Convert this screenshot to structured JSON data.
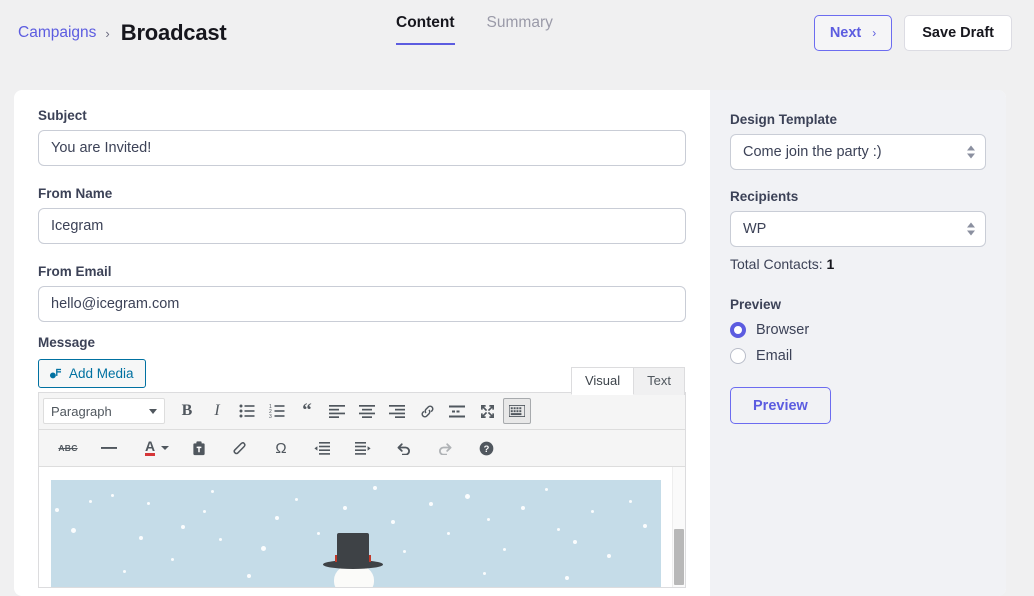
{
  "header": {
    "breadcrumb_parent": "Campaigns",
    "breadcrumb_sep": "›",
    "breadcrumb_current": "Broadcast",
    "tabs": [
      {
        "label": "Content",
        "active": true
      },
      {
        "label": "Summary",
        "active": false
      }
    ],
    "next_label": "Next",
    "next_chevron": "›",
    "save_draft_label": "Save Draft"
  },
  "form": {
    "subject_label": "Subject",
    "subject_value": "You are Invited!",
    "from_name_label": "From Name",
    "from_name_value": "Icegram",
    "from_email_label": "From Email",
    "from_email_value": "hello@icegram.com",
    "message_label": "Message",
    "add_media_label": "Add Media"
  },
  "editor": {
    "mode_tabs": [
      {
        "label": "Visual",
        "active": true
      },
      {
        "label": "Text",
        "active": false
      }
    ],
    "paragraph_select": "Paragraph",
    "toolbar_row1": [
      "bold-icon",
      "italic-icon",
      "bulleted-list-icon",
      "numbered-list-icon",
      "blockquote-icon",
      "align-left-icon",
      "align-center-icon",
      "align-right-icon",
      "insert-link-icon",
      "read-more-icon",
      "fullscreen-icon",
      "toolbar-toggle-icon"
    ],
    "toolbar_row2": [
      "strikethrough-icon",
      "horizontal-rule-icon",
      "text-color-icon",
      "paste-as-text-icon",
      "clear-formatting-icon",
      "special-character-icon",
      "decrease-indent-icon",
      "increase-indent-icon",
      "undo-icon",
      "redo-icon",
      "keyboard-shortcuts-icon"
    ],
    "content_alt": "Winter snow scene with snowman wearing a black top hat and red band"
  },
  "sidebar": {
    "design_template_label": "Design Template",
    "design_template_value": "Come join the party :)",
    "recipients_label": "Recipients",
    "recipients_value": "WP",
    "total_contacts_label": "Total Contacts:",
    "total_contacts_value": "1",
    "preview_label": "Preview",
    "preview_options": [
      {
        "label": "Browser",
        "selected": true
      },
      {
        "label": "Email",
        "selected": false
      }
    ],
    "preview_button_label": "Preview"
  },
  "colors": {
    "accent": "#5c5ce0",
    "page_bg": "#f0f0f1",
    "panel_bg": "#f1f2f5",
    "text": "#3c4257",
    "wp_blue": "#0071a1",
    "snow_sky": "#c5dce8",
    "hat_band": "#c0392b"
  }
}
